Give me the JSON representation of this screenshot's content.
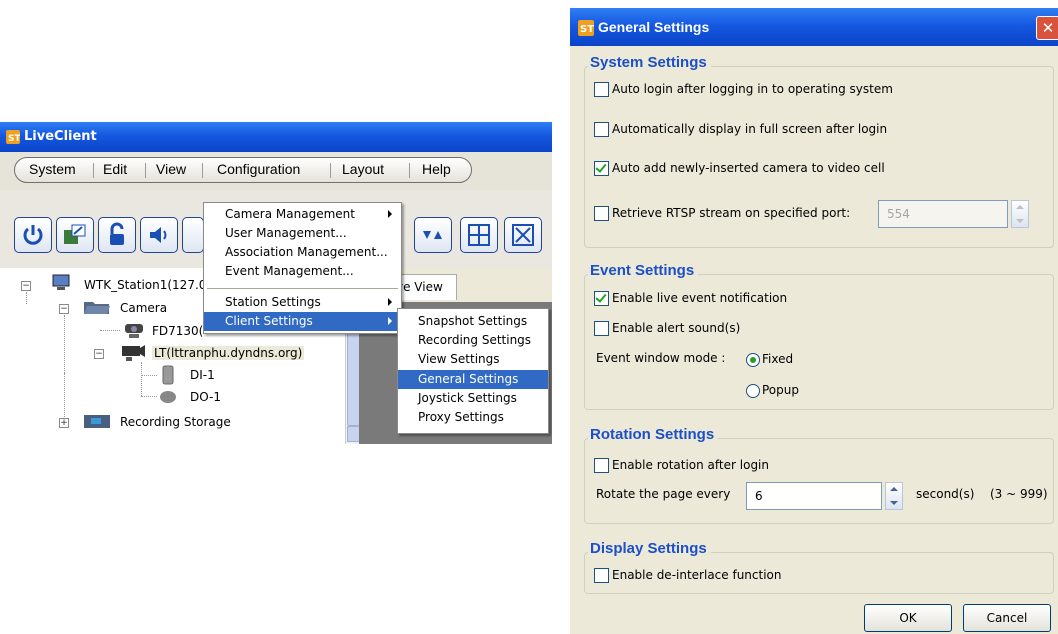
{
  "liveclient": {
    "title": "LiveClient",
    "menu": [
      "System",
      "Edit",
      "View",
      "Configuration",
      "Layout",
      "Help"
    ],
    "tree": {
      "station": "WTK_Station1(127.0",
      "camera_group": "Camera",
      "camera1": "FD7130(",
      "camera2": "LT(lttranphu.dyndns.org)",
      "di": "DI-1",
      "do": "DO-1",
      "recording_storage": "Recording Storage"
    },
    "live_view_tab": "ve View",
    "config_menu": {
      "items": [
        "Camera Management",
        "User Management...",
        "Association Management...",
        "Event Management..."
      ],
      "station_settings": "Station Settings",
      "client_settings": "Client Settings"
    },
    "client_submenu": [
      "Snapshot Settings",
      "Recording Settings",
      "View Settings",
      "General Settings",
      "Joystick Settings",
      "Proxy Settings"
    ]
  },
  "dialog": {
    "title": "General Settings",
    "close_glyph": "✕",
    "system": {
      "heading": "System Settings",
      "auto_login": {
        "label": "Auto login after logging in to operating system",
        "checked": false
      },
      "fullscreen": {
        "label": "Automatically display in full screen after login",
        "checked": false
      },
      "auto_add": {
        "label": "Auto add newly-inserted camera to video cell",
        "checked": true
      },
      "rtsp": {
        "label": "Retrieve RTSP stream on specified port:",
        "checked": false,
        "port": "554"
      }
    },
    "event": {
      "heading": "Event Settings",
      "live_notify": {
        "label": "Enable live event notification",
        "checked": true
      },
      "alert_sound": {
        "label": "Enable alert sound(s)",
        "checked": false
      },
      "window_mode_label": "Event window mode :",
      "mode_fixed": "Fixed",
      "mode_popup": "Popup",
      "selected_mode": "Fixed"
    },
    "rotation": {
      "heading": "Rotation Settings",
      "enable": {
        "label": "Enable rotation after login",
        "checked": false
      },
      "rotate_label": "Rotate the page every",
      "rotate_value": "6",
      "unit": "second(s)",
      "range": "(3 ~ 999)"
    },
    "display": {
      "heading": "Display Settings",
      "deinterlace": {
        "label": "Enable de-interlace function",
        "checked": false
      }
    },
    "ok": "OK",
    "cancel": "Cancel"
  },
  "colors": {
    "titlebar": "#1558e0",
    "group_heading": "#1c50c8",
    "check_mark": "#21a121",
    "menu_highlight": "#316ac5"
  }
}
